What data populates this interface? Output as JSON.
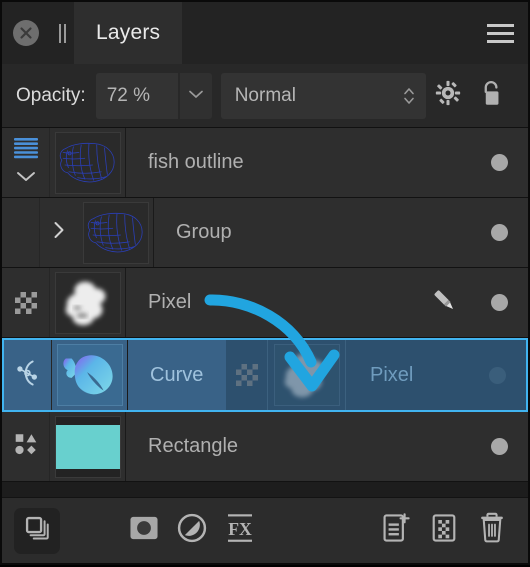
{
  "header": {
    "close_icon": "close-circle-icon",
    "pause_icon": "pause-divider-icon",
    "tab_label": "Layers",
    "menu_icon": "hamburger-menu-icon"
  },
  "options_bar": {
    "opacity_label": "Opacity:",
    "opacity_value": "72 %",
    "opacity_dropdown_icon": "chevron-down-icon",
    "blend_mode": "Normal",
    "blend_stepper_icon": "stepper-updown-icon",
    "settings_icon": "gear-icon",
    "lock_icon": "lock-open-icon"
  },
  "layers": [
    {
      "name": "fish outline",
      "type_icon": "lines-stripes-icon",
      "expander_icon": "chevron-down-icon",
      "thumbnail": "fish-outline-thumbnail",
      "visible_dot": "visibility-dot",
      "indented": false,
      "selected": false,
      "has_brush": false
    },
    {
      "name": "Group",
      "type_icon": "none",
      "expander_icon": "chevron-right-icon",
      "thumbnail": "fish-outline-thumbnail",
      "visible_dot": "visibility-dot",
      "indented": true,
      "selected": false,
      "has_brush": false
    },
    {
      "name": "Pixel",
      "type_icon": "checkerboard-icon",
      "expander_icon": "none",
      "thumbnail": "cloud-smoke-thumbnail",
      "visible_dot": "visibility-dot",
      "indented": false,
      "selected": false,
      "has_brush": true,
      "brush_icon": "paintbrush-icon"
    },
    {
      "name": "Curve",
      "type_icon": "bezier-curve-icon",
      "expander_icon": "none",
      "thumbnail": "fish-gradient-thumbnail",
      "visible_dot": "visibility-dot",
      "indented": false,
      "selected": true,
      "has_brush": false
    },
    {
      "name": "Rectangle",
      "type_icon": "shapes-icon",
      "expander_icon": "none",
      "thumbnail": "teal-rectangle-thumbnail",
      "visible_dot": "visibility-dot",
      "indented": false,
      "selected": false,
      "has_brush": false
    }
  ],
  "drag_ghost": {
    "name": "Pixel",
    "type_icon": "checkerboard-icon",
    "thumbnail": "cloud-smoke-thumbnail"
  },
  "annotation": {
    "arrow_icon": "curved-arrow-annotation",
    "arrow_color": "#21A5E0"
  },
  "bottom_bar": {
    "stack_button": "layer-stack-button",
    "mask_icon": "add-mask-icon",
    "adjustment_icon": "add-adjustment-icon",
    "fx_icon": "add-effects-icon",
    "add_layer_icon": "add-layer-icon",
    "add_pixel_layer_icon": "add-pixel-layer-icon",
    "delete_icon": "trash-delete-icon"
  },
  "colors": {
    "panel_bg": "#232323",
    "row_bg": "#2e2e2e",
    "selection_border": "#41b4f0",
    "selection_fill": "#396287",
    "accent_blue": "#21A5E0",
    "thumbnail_teal": "#68D0CE",
    "stripe_blue": "#4a90d9"
  }
}
